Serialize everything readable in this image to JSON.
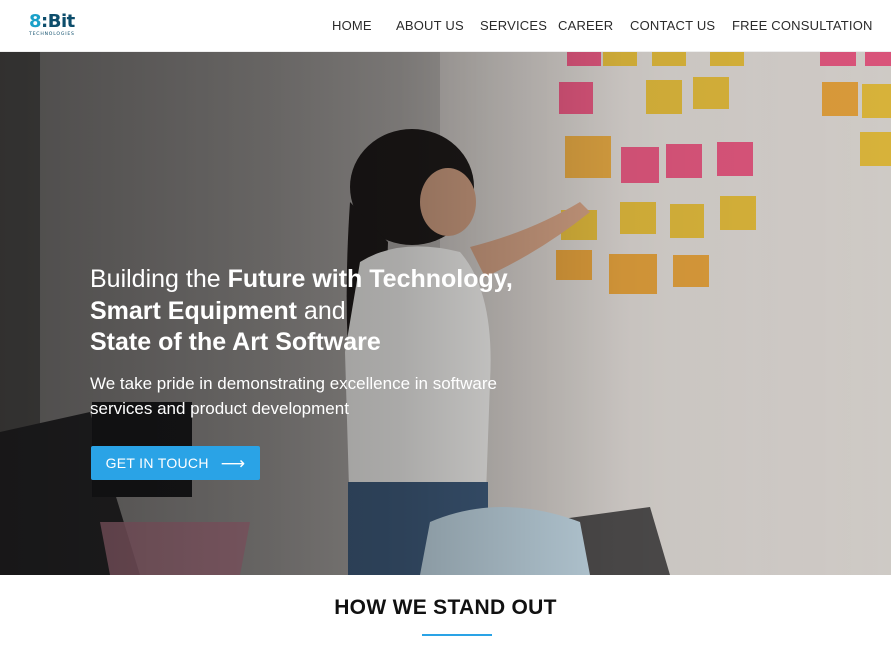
{
  "brand": {
    "logo_text": "8:Bit",
    "logo_digit": "8",
    "logo_rest": ":Bit",
    "logo_sub": "TECHNOLOGIES"
  },
  "nav": {
    "items": [
      {
        "label": "HOME"
      },
      {
        "label": "ABOUT US"
      },
      {
        "label": "SERVICES"
      },
      {
        "label": "CAREER"
      },
      {
        "label": "CONTACT US"
      },
      {
        "label": "FREE CONSULTATION"
      }
    ]
  },
  "hero": {
    "line1_pre": "Building the ",
    "line1_bold": "Future with Technology,",
    "line2_bold": "Smart Equipment",
    "line2_post": " and",
    "line3_bold": "State of the Art Software",
    "subline": "We take pride in demonstrating excellence in software services and product development",
    "cta_label": "GET IN TOUCH",
    "cta_icon": "arrow-right-icon"
  },
  "section": {
    "title": "HOW WE STAND OUT"
  },
  "colors": {
    "accent": "#2aa3e6",
    "logo_dark": "#0d4d6b",
    "logo_light": "#1aa0c8"
  }
}
